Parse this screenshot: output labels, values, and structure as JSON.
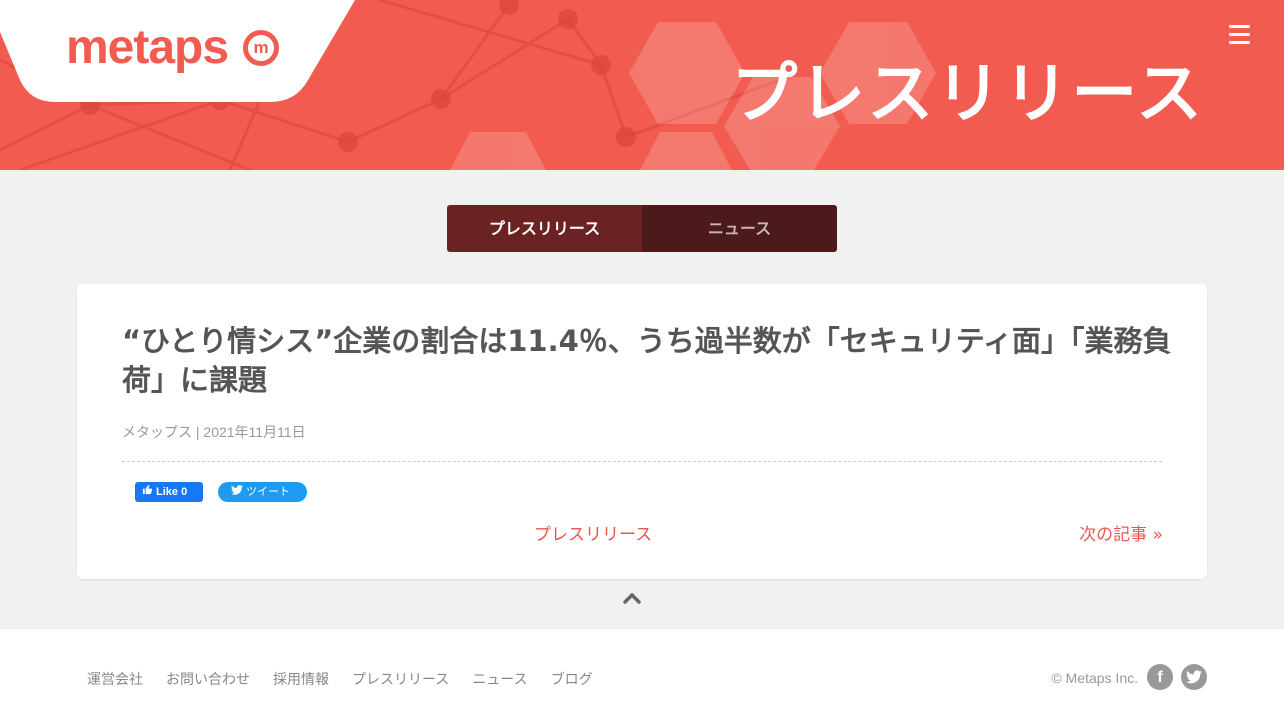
{
  "header": {
    "logo_text": "metaps",
    "logo_mark": "m",
    "hero_title": "プレスリリース",
    "menu_icon": "hamburger-menu-icon",
    "brand_color": "#f25b4f"
  },
  "tabs": [
    {
      "label": "プレスリリース",
      "active": true
    },
    {
      "label": "ニュース",
      "active": false
    }
  ],
  "article": {
    "title": "“ひとり情シス”企業の割合は11.4％、うち過半数が「セキュリティ面」「業務負荷」に課題",
    "meta": "メタップス | 2021年11月11日",
    "fb_like_label": "Like 0",
    "tweet_label": "ツイート",
    "category_link": "プレスリリース",
    "next_link": "次の記事 »"
  },
  "footer": {
    "nav": [
      "運営会社",
      "お問い合わせ",
      "採用情報",
      "プレスリリース",
      "ニュース",
      "ブログ"
    ],
    "copyright": "© Metaps Inc.",
    "facebook_icon": "f"
  },
  "colors": {
    "tab_active": "#6a2222",
    "tab_inactive": "#4c1a1a",
    "link": "#e9574c"
  }
}
